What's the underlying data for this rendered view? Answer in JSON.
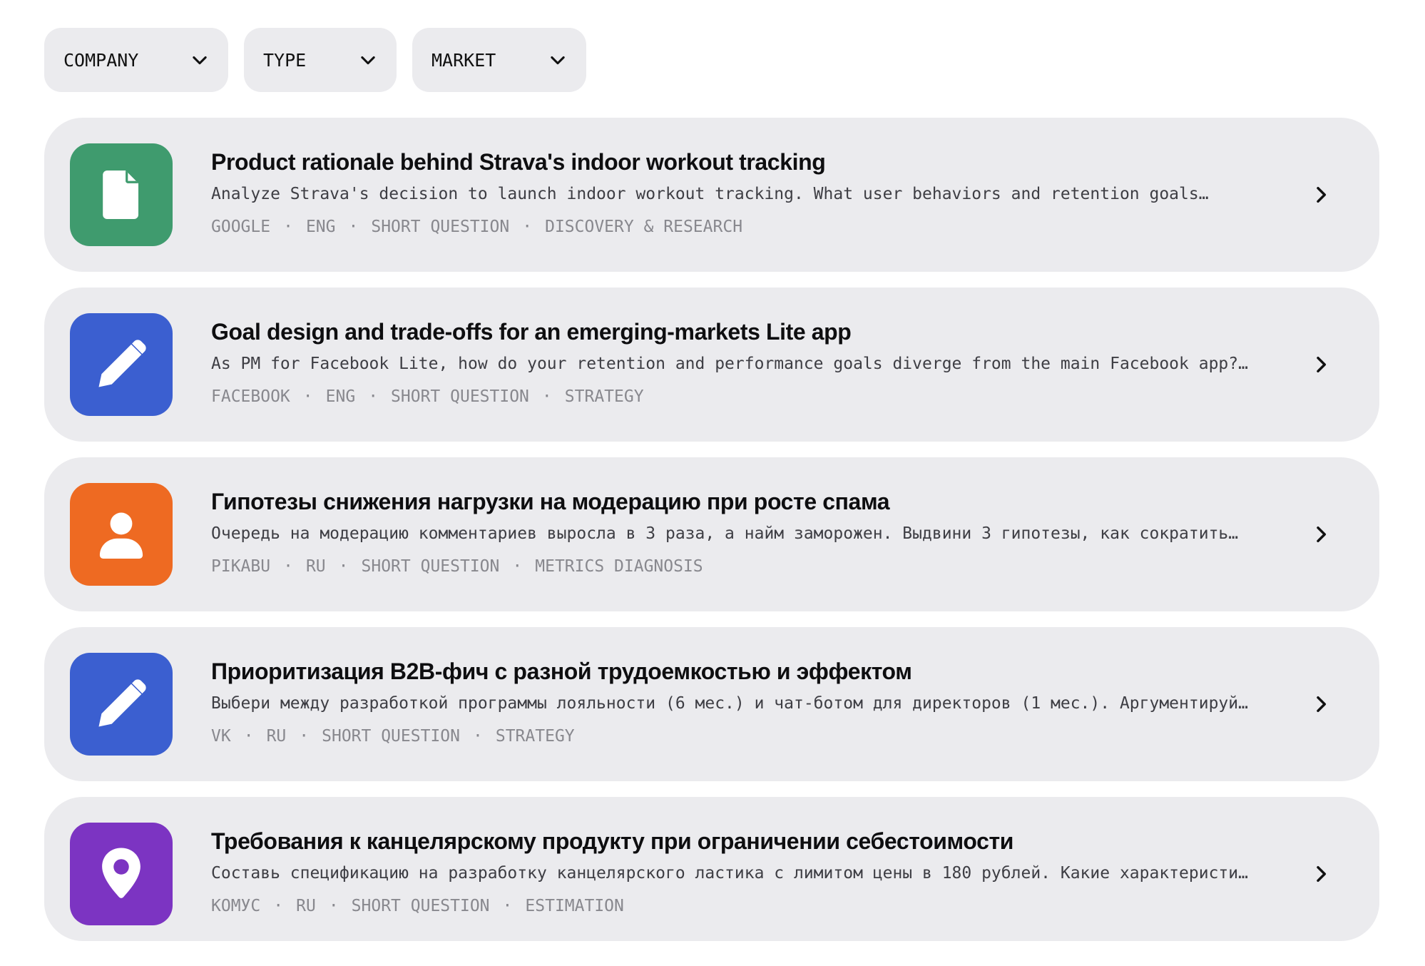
{
  "filters": [
    {
      "label": "COMPANY",
      "icon": "chevron-down-icon"
    },
    {
      "label": "TYPE",
      "icon": "chevron-down-icon"
    },
    {
      "label": "MARKET",
      "icon": "chevron-down-icon"
    }
  ],
  "colors": {
    "green": "#3f9b6e",
    "blue": "#3b5fd0",
    "orange": "#ee6a22",
    "purple": "#7c34c2",
    "card_bg": "#ebebee"
  },
  "questions": [
    {
      "icon": "document-icon",
      "color": "#3f9b6e",
      "title": "Product rationale behind Strava's indoor workout tracking",
      "description": "Analyze Strava's decision to launch indoor workout tracking. What user behaviors and retention goals…",
      "company": "GOOGLE",
      "language": "ENG",
      "format": "SHORT QUESTION",
      "category": "DISCOVERY & RESEARCH"
    },
    {
      "icon": "pencil-icon",
      "color": "#3b5fd0",
      "title": "Goal design and trade-offs for an emerging-markets Lite app",
      "description": "As PM for Facebook Lite, how do your retention and performance goals diverge from the main Facebook app?…",
      "company": "FACEBOOK",
      "language": "ENG",
      "format": "SHORT QUESTION",
      "category": "STRATEGY"
    },
    {
      "icon": "user-icon",
      "color": "#ee6a22",
      "title": "Гипотезы снижения нагрузки на модерацию при росте спама",
      "description": "Очередь на модерацию комментариев выросла в 3 раза, а найм заморожен. Выдвини 3 гипотезы, как сократить…",
      "company": "PIKABU",
      "language": "RU",
      "format": "SHORT QUESTION",
      "category": "METRICS DIAGNOSIS"
    },
    {
      "icon": "pencil-icon",
      "color": "#3b5fd0",
      "title": "Приоритизация B2B-фич с разной трудоемкостью и эффектом",
      "description": "Выбери между разработкой программы лояльности (6 мес.) и чат-ботом для директоров (1 мес.). Аргументируй…",
      "company": "VK",
      "language": "RU",
      "format": "SHORT QUESTION",
      "category": "STRATEGY"
    },
    {
      "icon": "map-pin-icon",
      "color": "#7c34c2",
      "title": "Требования к канцелярскому продукту при ограничении себестоимости",
      "description": "Составь спецификацию на разработку канцелярского ластика с лимитом цены в 180 рублей. Какие характеристик…",
      "company": "КОМУС",
      "language": "RU",
      "format": "SHORT QUESTION",
      "category": "ESTIMATION"
    }
  ]
}
